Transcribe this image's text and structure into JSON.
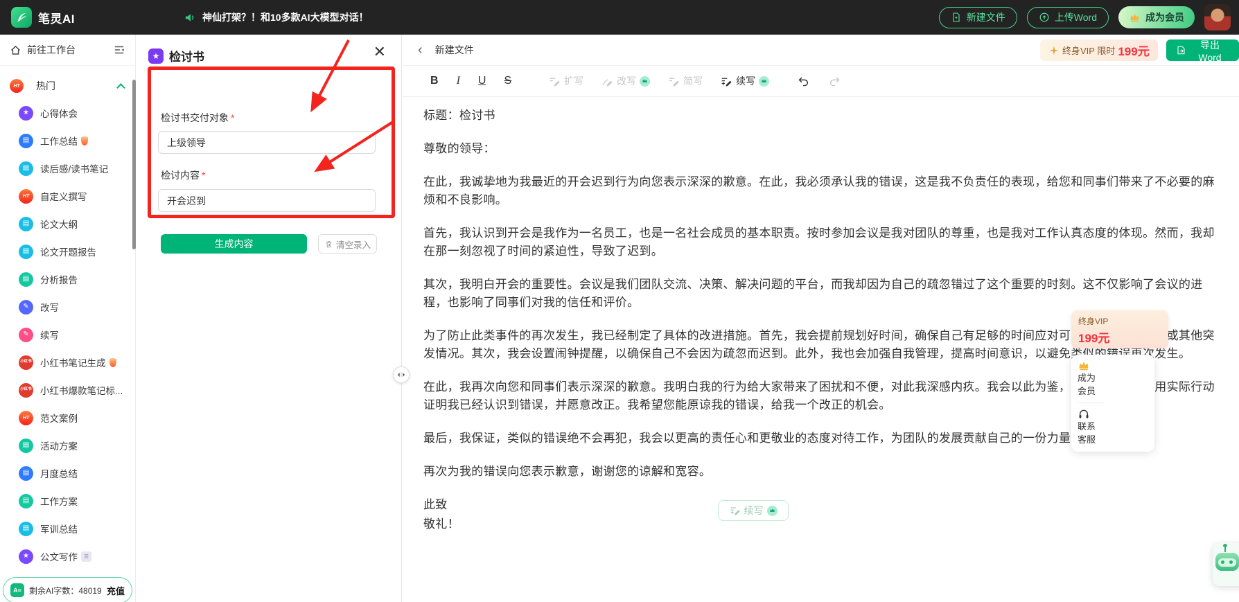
{
  "topbar": {
    "logo": "笔灵AI",
    "announcement": "神仙打架？！和10多款AI大模型对话！",
    "new_file": "新建文件",
    "upload_word": "上传Word",
    "become_member": "成为会员"
  },
  "sidebar": {
    "workspace": "前往工作台",
    "hot": "热门",
    "items": [
      {
        "label": "心得体会",
        "color": "#7b49ff",
        "glyph": "★",
        "type": "star"
      },
      {
        "label": "工作总结",
        "color": "#2d7bff",
        "glyph": "▤",
        "type": "case",
        "flame": true
      },
      {
        "label": "读后感/读书笔记",
        "color": "#19bde6",
        "glyph": "▤",
        "type": "book"
      },
      {
        "label": "自定义撰写",
        "color": "#ff4a2d",
        "glyph": "HT",
        "type": "hot"
      },
      {
        "label": "论文大纲",
        "color": "#19bde6",
        "glyph": "▤",
        "type": "book"
      },
      {
        "label": "论文开题报告",
        "color": "#19bde6",
        "glyph": "▤",
        "type": "book"
      },
      {
        "label": "分析报告",
        "color": "#14c9a2",
        "glyph": "▤",
        "type": "doc"
      },
      {
        "label": "改写",
        "color": "#5468ff",
        "glyph": "✎",
        "type": "pen"
      },
      {
        "label": "续写",
        "color": "#ff4d88",
        "glyph": "✎",
        "type": "pen"
      },
      {
        "label": "小红书笔记生成",
        "color": "#e23a2e",
        "glyph": "小红书",
        "type": "xhs",
        "flame": true
      },
      {
        "label": "小红书爆款笔记标...",
        "color": "#e23a2e",
        "glyph": "小红书",
        "type": "xhs"
      },
      {
        "label": "范文案例",
        "color": "#ff4a2d",
        "glyph": "HT",
        "type": "hot"
      },
      {
        "label": "活动方案",
        "color": "#14c9a2",
        "glyph": "▤",
        "type": "doc"
      },
      {
        "label": "月度总结",
        "color": "#2d7bff",
        "glyph": "▤",
        "type": "case"
      },
      {
        "label": "工作方案",
        "color": "#14c9a2",
        "glyph": "▤",
        "type": "doc"
      },
      {
        "label": "军训总结",
        "color": "#19bde6",
        "glyph": "▤",
        "type": "book"
      },
      {
        "label": "公文写作",
        "color": "#7b49ff",
        "glyph": "★",
        "type": "star",
        "doc_badge": true
      }
    ],
    "footer": {
      "label": "剩余AI字数：",
      "value": "48019",
      "recharge": "充值"
    }
  },
  "form": {
    "title": "检讨书",
    "fields": [
      {
        "label": "检讨书交付对象",
        "value": "上级领导"
      },
      {
        "label": "检讨内容",
        "value": "开会迟到"
      }
    ],
    "generate": "生成内容",
    "clear": "清空录入"
  },
  "editor": {
    "breadcrumb": "新建文件",
    "vip_text": "终身VIP 限时",
    "vip_price": "199元",
    "export": "导出Word",
    "tools": {
      "bold": "B",
      "italic": "I",
      "underline": "U",
      "strike": "S",
      "expand": "扩写",
      "rewrite": "改写",
      "simplify": "简写",
      "continue": "续写"
    },
    "doc": {
      "title": "标题：检讨书",
      "salutation": "尊敬的领导：",
      "paragraphs": [
        "在此，我诚挚地为我最近的开会迟到行为向您表示深深的歉意。在此，我必须承认我的错误，这是我不负责任的表现，给您和同事们带来了不必要的麻烦和不良影响。",
        "首先，我认识到开会是我作为一名员工，也是一名社会成员的基本职责。按时参加会议是我对团队的尊重，也是我对工作认真态度的体现。然而，我却在那一刻忽视了时间的紧迫性，导致了迟到。",
        "其次，我明白开会的重要性。会议是我们团队交流、决策、解决问题的平台，而我却因为自己的疏忽错过了这个重要的时刻。这不仅影响了会议的进程，也影响了同事们对我的信任和评价。",
        "为了防止此类事件的再次发生，我已经制定了具体的改进措施。首先，我会提前规划好时间，确保自己有足够的时间应对可能出现的交通问题或其他突发情况。其次，我会设置闹钟提醒，以确保自己不会因为疏忽而迟到。此外，我也会加强自我管理，提高时间意识，以避免类似的错误再次发生。",
        "在此，我再次向您和同事们表示深深的歉意。我明白我的行为给大家带来了困扰和不便，对此我深感内疚。我会以此为鉴，严格要求自己，用实际行动证明我已经认识到错误，并愿意改正。我希望您能原谅我的错误，给我一个改正的机会。",
        "最后，我保证，类似的错误绝不会再犯，我会以更高的责任心和更敬业的态度对待工作，为团队的发展贡献自己的一份力量。",
        "再次为我的错误向您表示歉意，谢谢您的谅解和宽容。"
      ],
      "closing": "此致",
      "salute": "敬礼！"
    },
    "continue_btn": "续写"
  },
  "floating": {
    "vip_line1": "终身VIP",
    "vip_line2": "199元",
    "member": [
      "成为",
      "会员"
    ],
    "service": [
      "联系",
      "客服"
    ]
  },
  "colors": {
    "accent": "#00b376",
    "annotation_red": "#f3241d",
    "topbar": "#232323"
  }
}
